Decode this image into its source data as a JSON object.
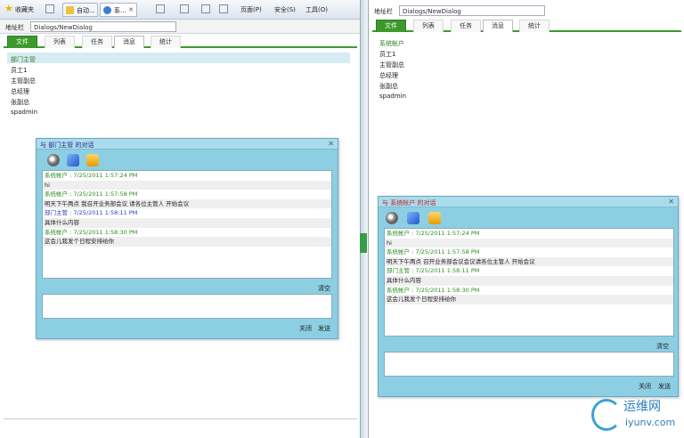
{
  "left_window": {
    "toolbar": {
      "favorites": "收藏夹",
      "tabs": [
        {
          "label": "自动...",
          "icon": "doc-icon"
        },
        {
          "label": "系...",
          "icon": "ie-icon"
        }
      ],
      "page_menu": "页面(P)",
      "safety_menu": "安全(S)",
      "tools_menu": "工具(O)"
    },
    "address": {
      "label": "地址栏",
      "value": "Dialogs/NewDialog"
    },
    "app_tabs": [
      "文件",
      "列表",
      "任务",
      "消息",
      "统计"
    ],
    "contacts": {
      "header": "部门主管",
      "items": [
        "员工1",
        "主管副总",
        "总经理",
        "张副总",
        "spadmin"
      ]
    },
    "dialog": {
      "title": "与 部门主管 的对话",
      "messages": [
        {
          "sender": "系统帐户 : 7/25/2011 1:57:24 PM",
          "text": "hi",
          "color": "green"
        },
        {
          "sender": "系统帐户 : 7/25/2011 1:57:58 PM",
          "text": "明天下午两点 我召开业务部会议 请各位主管人 开始会议",
          "color": "green"
        },
        {
          "sender": "部门主管 : 7/25/2011 1:58:11 PM",
          "text": "具体什么内容",
          "color": "blue"
        },
        {
          "sender": "系统帐户 : 7/25/2011 1:58:30 PM",
          "text": "这会儿我发个日程安排给你",
          "color": "green"
        }
      ],
      "send_label": "清空",
      "close_button": "关闭",
      "send_button": "发送"
    }
  },
  "right_window": {
    "address": {
      "label": "地址栏",
      "value": "Dialogs/NewDialog"
    },
    "app_tabs": [
      "文件",
      "列表",
      "任务",
      "消息",
      "统计"
    ],
    "contacts": {
      "header": "系统帐户",
      "items": [
        "员工1",
        "主管副总",
        "总经理",
        "张副总",
        "spadmin"
      ]
    },
    "dialog": {
      "title": "与 系统帐户 的对话",
      "messages": [
        {
          "sender": "系统帐户 : 7/25/2011 1:57:24 PM",
          "text": "hi",
          "color": "green"
        },
        {
          "sender": "系统帐户 : 7/25/2011 1:57:58 PM",
          "text": "明天下午两点 召开业务部会议会议请各位主管人 开始会议",
          "color": "green"
        },
        {
          "sender": "部门主管 : 7/25/2011 1:58:11 PM",
          "text": "具体什么内容",
          "color": "green"
        },
        {
          "sender": "系统帐户 : 7/25/2011 1:58:30 PM",
          "text": "这会儿我发个日程安排给你",
          "color": "green"
        }
      ],
      "send_label": "清空",
      "close_button": "关闭",
      "send_button": "发送"
    }
  },
  "watermark": {
    "cn": "运维网",
    "en": "iyunv.com"
  },
  "colors": {
    "accent_green": "#3c9a2c",
    "dialog_bg": "#8ccfe3",
    "sender_green": "#2f8c22",
    "sender_blue": "#2d3dbf"
  }
}
